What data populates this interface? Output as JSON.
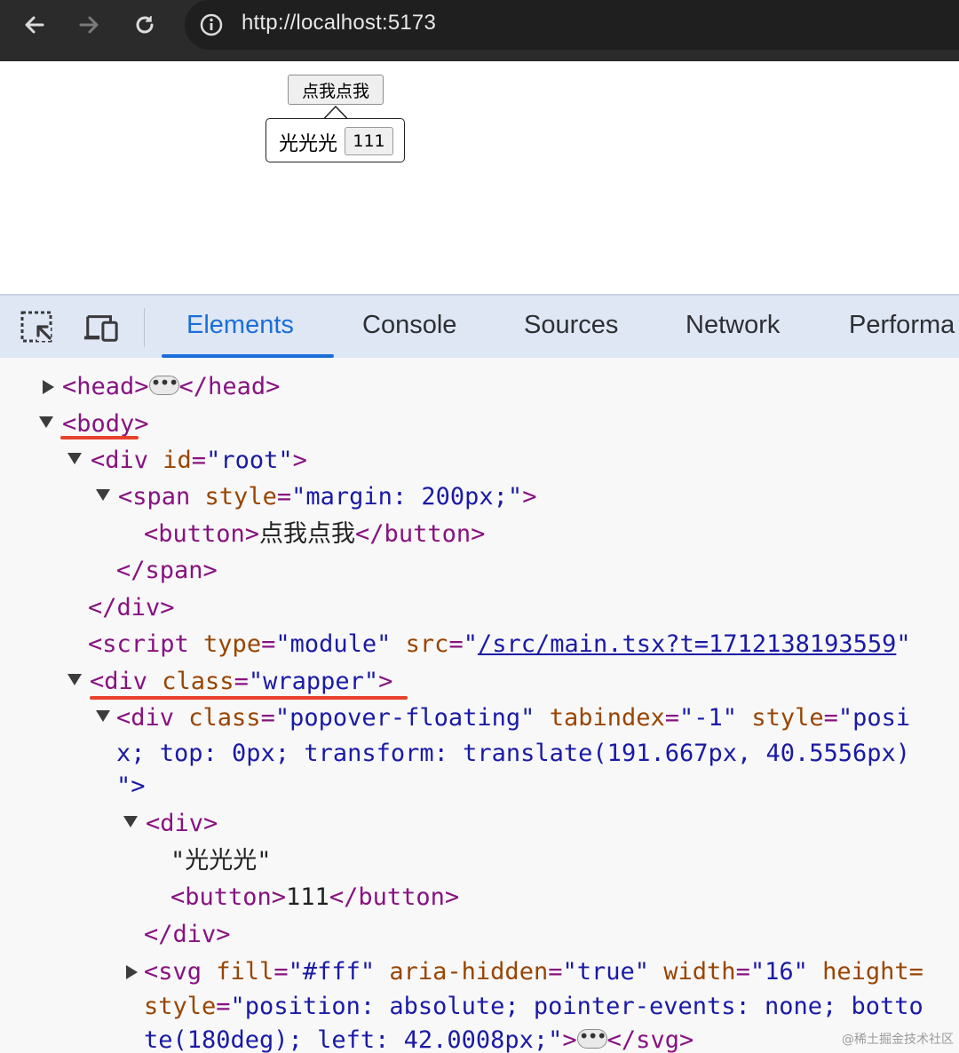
{
  "browser": {
    "url": "http://localhost:5173",
    "back_icon": "arrow-left-icon",
    "forward_icon": "arrow-right-icon",
    "reload_icon": "reload-icon",
    "info_icon": "info-icon"
  },
  "page": {
    "button_label": "点我点我",
    "popover_text": "光光光",
    "popover_button_label": "111"
  },
  "devtools": {
    "tabs": [
      "Elements",
      "Console",
      "Sources",
      "Network",
      "Performa"
    ],
    "active_tab": "Elements"
  },
  "tree": {
    "head_open": "<head>",
    "head_close": "</head>",
    "body_open": "<body",
    "body_end": ">",
    "div_root_open": "<div ",
    "id_attr": "id",
    "root_val": "\"root\"",
    "gt": ">",
    "span_open": "<span ",
    "style_attr": "style",
    "margin_val": "\"margin: 200px;\"",
    "button_open": "<button>",
    "button_text": "点我点我",
    "button_close": "</button>",
    "span_close": "</span>",
    "div_close": "</div>",
    "script_open": "<script ",
    "type_attr": "type",
    "module_val": "\"module\"",
    "src_attr": "src",
    "src_val": "/src/main.tsx?t=1712138193559",
    "div_open": "<div ",
    "class_attr": "class",
    "wrapper_val": "\"wrapper\"",
    "popover_class_val": "\"popover-floating\"",
    "tabindex_attr": "tabindex",
    "tabindex_val": "\"-1\"",
    "style_partial_val": "\"posi",
    "style_line2": "x; top: 0px; transform: translate(191.667px, 40.5556px)",
    "style_line3": "\">",
    "div_plain_open": "<div>",
    "text_node": "\"光光光\"",
    "btn111_text": "111",
    "svg_open": "<svg ",
    "fill_attr": "fill",
    "fill_val": "\"#fff\"",
    "aria_attr": "aria-hidden",
    "aria_val": "\"true\"",
    "width_attr": "width",
    "width_val": "\"16\"",
    "height_partial": "height=",
    "svg_style_line": "\"position: absolute; pointer-events: none; botto",
    "svg_style_line3": "te(180deg); left: 42.0008px;\"",
    "svg_close": "</svg>",
    "equals": "="
  },
  "watermark": "@稀土掘金技术社区"
}
